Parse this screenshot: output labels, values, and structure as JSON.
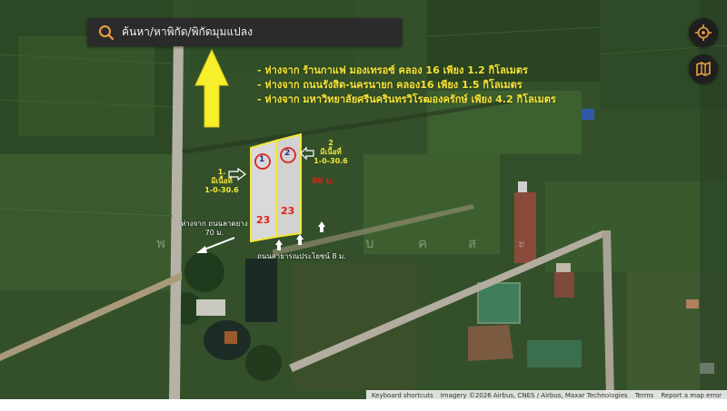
{
  "search": {
    "placeholder": "ค้นหา/หาพิกัด/พิกัดมุมแปลง"
  },
  "controls": {
    "locate_icon": "crosshair-icon",
    "layers_icon": "map-icon",
    "search_icon": "search-icon"
  },
  "info_lines": [
    "- ห่างจาก ร้านกาแฟ มองเทรอซ์ คลอง 16 เพียง 1.2 กิโลเมตร",
    "- ห่างจาก ถนนรังสิต-นครนายก คลอง16 เพียง 1.5 กิโลเมตร",
    "- ห่างจาก มหาวิทยาลัยศรีนครินทรวิโรฒองครักษ์ เพียง 4.2 กิโลเมตร"
  ],
  "plots": [
    {
      "number": "1",
      "bottom_number": "23",
      "label_line1": "1.",
      "label_line2": "มีเนื้อที่",
      "label_line3": "1-0-30.6"
    },
    {
      "number": "2",
      "bottom_number": "23",
      "label_line1": "2",
      "label_line2": "มีเนื้อที่",
      "label_line3": "1-0-30.6"
    }
  ],
  "dimension_label": "86 ม.",
  "road_distance": {
    "line1": "ห่างจาก ถนนลาดยาง",
    "line2": "70 ม."
  },
  "public_road": "ถนนสาธารณประโยชน์ 8 ม.",
  "watermark_chars": [
    "พ",
    "บ",
    "ค",
    "ส",
    "ะ"
  ],
  "colors": {
    "accent": "#f3e63a",
    "plot_fill": "#d9d9d9",
    "marker_red": "#d9261c",
    "arrow": "#f6ef2a"
  },
  "attribution": {
    "shortcuts": "Keyboard shortcuts",
    "imagery": "Imagery ©2026 Airbus, CNES / Airbus, Maxar Technologies",
    "terms": "Terms",
    "report": "Report a map error"
  }
}
